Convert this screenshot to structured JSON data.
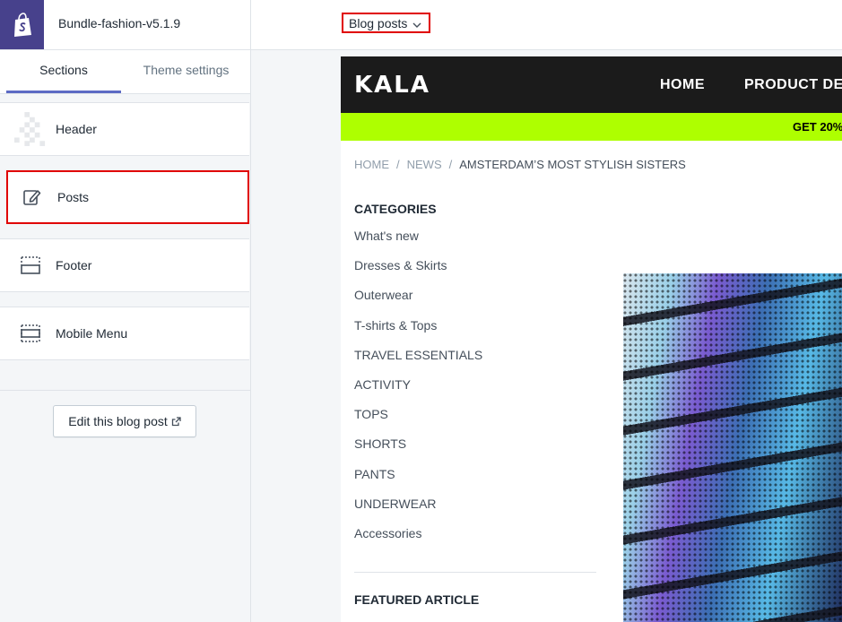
{
  "app": {
    "theme_name": "Bundle-fashion-v5.1.9",
    "template_select": "Blog posts"
  },
  "sidebar": {
    "tabs": [
      {
        "label": "Sections",
        "active": true
      },
      {
        "label": "Theme settings",
        "active": false
      }
    ],
    "sections": [
      {
        "label": "Header",
        "icon": "header-thumbnail-icon"
      },
      {
        "label": "Posts",
        "icon": "edit-pencil-icon",
        "highlighted": true
      },
      {
        "label": "Footer",
        "icon": "footer-layout-icon"
      },
      {
        "label": "Mobile Menu",
        "icon": "mobile-menu-layout-icon"
      }
    ],
    "edit_button": "Edit this blog post"
  },
  "preview": {
    "logo": "KALA",
    "nav": [
      "HOME",
      "PRODUCT DE"
    ],
    "promo": "GET 20%",
    "breadcrumb": [
      "HOME",
      "NEWS",
      "AMSTERDAM’S MOST STYLISH SISTERS"
    ],
    "categories_heading": "CATEGORIES",
    "categories": [
      "What's new",
      "Dresses & Skirts",
      "Outerwear",
      "T-shirts & Tops",
      "TRAVEL ESSENTIALS",
      "ACTIVITY",
      "TOPS",
      "SHORTS",
      "PANTS",
      "UNDERWEAR",
      "Accessories"
    ],
    "featured_heading": "FEATURED ARTICLE"
  },
  "colors": {
    "brand": "#47418c",
    "accent": "#5c6ac4",
    "highlight": "#e00000",
    "promo": "#aeff00",
    "store_header": "#1b1b1b"
  }
}
